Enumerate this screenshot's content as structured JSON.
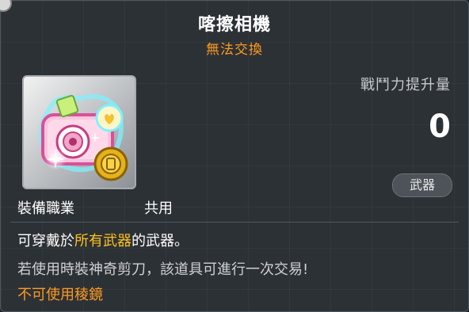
{
  "item": {
    "name": "喀擦相機",
    "trade_status": "無法交換",
    "icon": "pink-camera-icon"
  },
  "stats": {
    "power_increase_label": "戰鬥力提升量",
    "power_increase_value": "0",
    "category_tag": "武器"
  },
  "requirement": {
    "job_label": "裝備職業",
    "job_value": "共用"
  },
  "description": {
    "line1_prefix": "可穿戴於",
    "line1_highlight": "所有武器",
    "line1_suffix": "的武器。",
    "line2": "若使用時裝神奇剪刀，該道具可進行一次交易!",
    "line3": "不可使用稜鏡"
  },
  "colors": {
    "title": "#ffffff",
    "trade_status": "#ff9a1f",
    "highlight": "#ffc21a",
    "warning": "#ff9a1f",
    "background": "#2c3136"
  }
}
